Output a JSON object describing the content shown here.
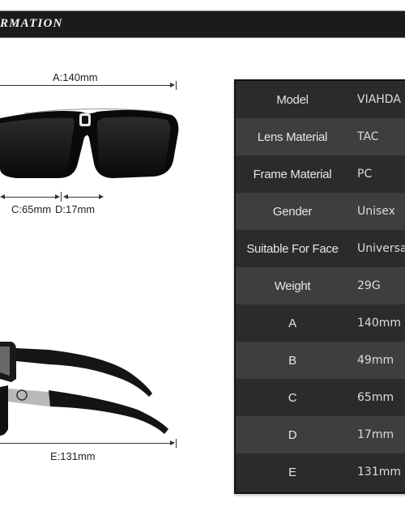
{
  "banner": {
    "title": "RMATION"
  },
  "dimensions": {
    "a_label": "A:140mm",
    "c_label": "C:65mm",
    "d_label": "D:17mm",
    "e_label": "E:131mm"
  },
  "images": {
    "front_view": "sunglasses-front-view",
    "side_view": "sunglasses-side-view"
  },
  "spec_table": {
    "rows": [
      {
        "key": "Model",
        "value": "VIAHDA"
      },
      {
        "key": "Lens Material",
        "value": "TAC"
      },
      {
        "key": "Frame Material",
        "value": "PC"
      },
      {
        "key": "Gender",
        "value": "Unisex"
      },
      {
        "key": "Suitable For Face",
        "value": "Universal"
      },
      {
        "key": "Weight",
        "value": "29G"
      },
      {
        "key": "A",
        "value": "140mm"
      },
      {
        "key": "B",
        "value": "49mm"
      },
      {
        "key": "C",
        "value": "65mm"
      },
      {
        "key": "D",
        "value": "17mm"
      },
      {
        "key": "E",
        "value": "131mm"
      }
    ]
  },
  "colors": {
    "banner_bg": "#1b1b1b",
    "table_dark_row": "#2b2b2b",
    "table_light_row": "#3e3e3e",
    "table_text": "#e6e6e6"
  }
}
